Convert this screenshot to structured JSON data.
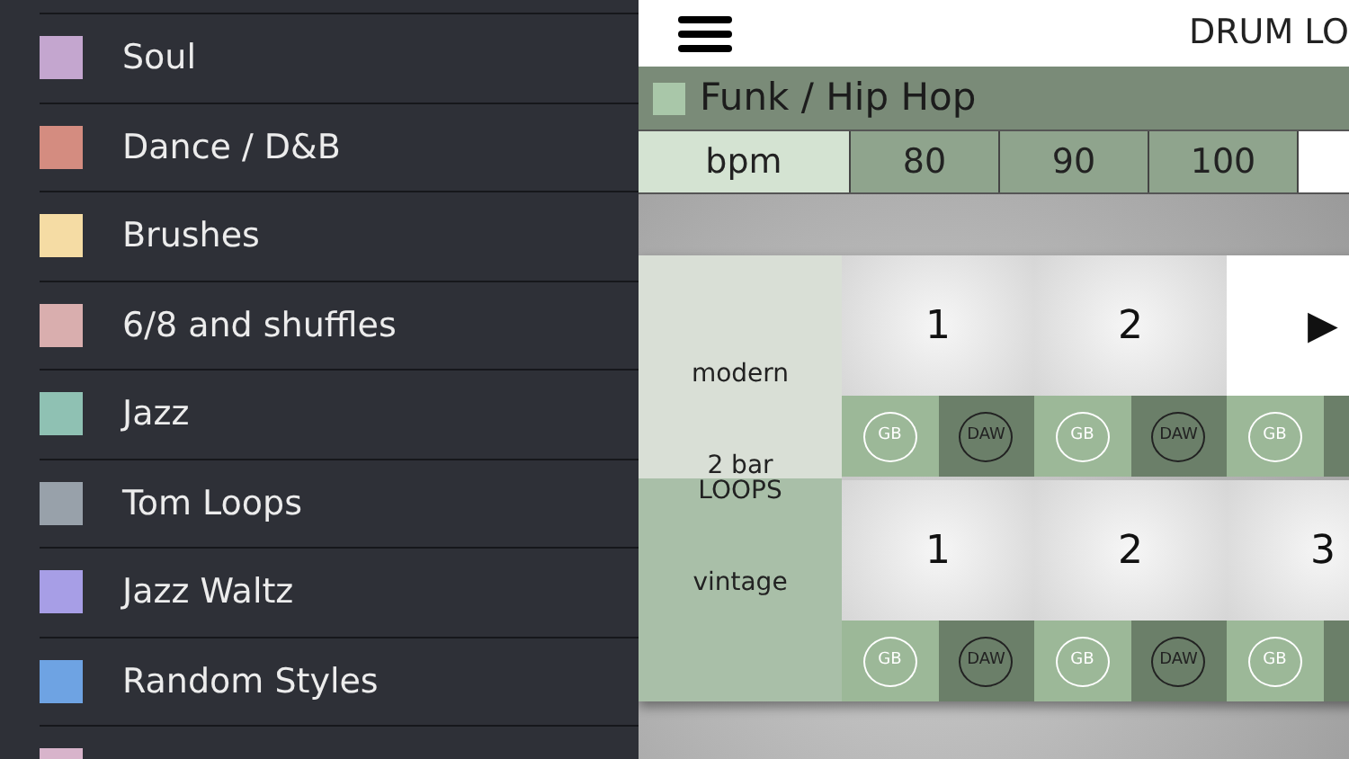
{
  "sidebar": {
    "items": [
      {
        "label": "Soul",
        "color": "#c4a6cf"
      },
      {
        "label": "Dance / D&B",
        "color": "#d48c80"
      },
      {
        "label": "Brushes",
        "color": "#f5dca4"
      },
      {
        "label": "6/8 and shuffles",
        "color": "#d9aeae"
      },
      {
        "label": "Jazz",
        "color": "#8fc1b3"
      },
      {
        "label": "Tom Loops",
        "color": "#98a1aa"
      },
      {
        "label": "Jazz Waltz",
        "color": "#a79ee6"
      },
      {
        "label": "Random Styles",
        "color": "#6ea3e3"
      },
      {
        "color": "#d8b4cb"
      }
    ]
  },
  "header": {
    "title": "DRUM LO"
  },
  "category": {
    "name": "Funk / Hip Hop",
    "color": "#a9c7a9"
  },
  "tempo": {
    "label": "bpm",
    "options": [
      {
        "label": "80",
        "selected": false
      },
      {
        "label": "90",
        "selected": false
      },
      {
        "label": "100",
        "selected": false
      }
    ]
  },
  "loops": {
    "title": "2 bar LOOPS",
    "rows": [
      {
        "name": "modern",
        "pads": [
          {
            "label": "1",
            "playing": false,
            "buttons": [
              "GB",
              "DAW"
            ]
          },
          {
            "label": "2",
            "playing": false,
            "buttons": [
              "GB",
              "DAW"
            ]
          },
          {
            "label": "▶",
            "playing": true,
            "buttons": [
              "GB"
            ]
          }
        ]
      },
      {
        "name": "vintage",
        "pads": [
          {
            "label": "1",
            "playing": false,
            "buttons": [
              "GB",
              "DAW"
            ]
          },
          {
            "label": "2",
            "playing": false,
            "buttons": [
              "GB",
              "DAW"
            ]
          },
          {
            "label": "3",
            "playing": false,
            "buttons": [
              "GB"
            ]
          }
        ]
      }
    ]
  }
}
